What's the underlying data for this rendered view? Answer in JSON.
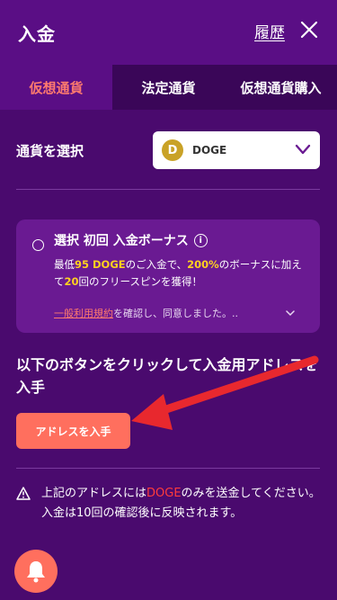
{
  "header": {
    "title": "入金",
    "history_label": "履歴"
  },
  "tabs": [
    {
      "label": "仮想通貨"
    },
    {
      "label": "法定通貨"
    },
    {
      "label": "仮想通貨購入"
    }
  ],
  "currency_select": {
    "label": "通貨を選択",
    "coin_symbol": "D",
    "selected": "DOGE"
  },
  "bonus": {
    "title": "選択 初回 入金ボーナス",
    "desc_1": "最低",
    "desc_min_amount": "95 DOGE",
    "desc_2": "のご入金で、",
    "desc_percent": "200%",
    "desc_3": "のボーナスに加えて",
    "desc_spins": "20",
    "desc_4": "回のフリースピンを獲得！",
    "terms_link": "一般利用規約",
    "terms_rest": "を確認し、同意しました。.."
  },
  "cta": {
    "text": "以下のボタンをクリックして入金用アドレスを入手",
    "button_label": "アドレスを入手"
  },
  "notice": {
    "text_1": "上記のアドレスには",
    "currency": "DOGE",
    "text_2": "のみを送金してください。入金は10回の確認後に反映されます。"
  },
  "colors": {
    "background": "#4a0a6e",
    "accent": "#ff6f5e",
    "highlight": "#ffd21e",
    "warning_text": "#ff3b3b",
    "arrow": "#e8282e"
  },
  "icons": [
    "close-icon",
    "chevron-down-icon",
    "info-icon",
    "warning-icon",
    "bell-icon",
    "doge-coin-icon"
  ]
}
